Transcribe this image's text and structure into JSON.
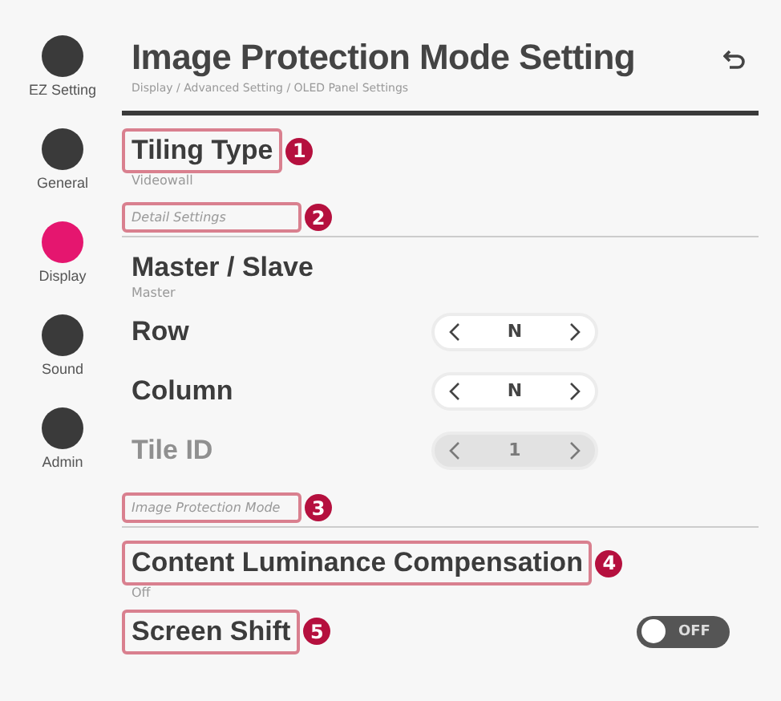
{
  "sidebar": {
    "items": [
      {
        "label": "EZ Setting",
        "selected": false
      },
      {
        "label": "General",
        "selected": false
      },
      {
        "label": "Display",
        "selected": true
      },
      {
        "label": "Sound",
        "selected": false
      },
      {
        "label": "Admin",
        "selected": false
      }
    ]
  },
  "header": {
    "title": "Image Protection Mode Setting",
    "breadcrumb": "Display / Advanced Setting / OLED Panel Settings"
  },
  "rows": [
    {
      "kind": "setting",
      "label": "Tiling Type",
      "value": "Videowall",
      "callout": "1"
    },
    {
      "kind": "section",
      "label": "Detail Settings",
      "callout": "2"
    },
    {
      "kind": "setting",
      "label": "Master / Slave",
      "value": "Master"
    },
    {
      "kind": "stepper",
      "label": "Row",
      "value": "N",
      "disabled": false
    },
    {
      "kind": "stepper",
      "label": "Column",
      "value": "N",
      "disabled": false
    },
    {
      "kind": "stepper",
      "label": "Tile ID",
      "value": "1",
      "disabled": true
    },
    {
      "kind": "section",
      "label": "Image Protection Mode",
      "callout": "3"
    },
    {
      "kind": "setting",
      "label": "Content Luminance Compensation",
      "value": "Off",
      "callout": "4"
    },
    {
      "kind": "toggle",
      "label": "Screen Shift",
      "on": false,
      "state_label": "OFF",
      "callout": "5"
    }
  ]
}
